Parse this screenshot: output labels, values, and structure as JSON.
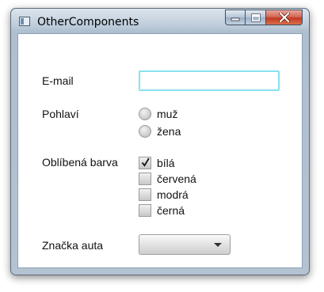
{
  "window": {
    "title": "OtherComponents",
    "caption_buttons": {
      "minimize": "minimize-icon",
      "maximize": "maximize-icon",
      "close": "close-icon"
    }
  },
  "form": {
    "email": {
      "label": "E-mail",
      "value": "",
      "placeholder": ""
    },
    "gender": {
      "label": "Pohlaví",
      "options": [
        {
          "label": "muž",
          "selected": false
        },
        {
          "label": "žena",
          "selected": false
        }
      ]
    },
    "favorite_color": {
      "label": "Oblíbená barva",
      "options": [
        {
          "label": "bílá",
          "checked": true
        },
        {
          "label": "červená",
          "checked": false
        },
        {
          "label": "modrá",
          "checked": false
        },
        {
          "label": "černá",
          "checked": false
        }
      ]
    },
    "car_brand": {
      "label": "Značka auta",
      "selected": ""
    }
  },
  "colors": {
    "focus_border": "#86e1ef",
    "close_button": "#c23a22"
  }
}
